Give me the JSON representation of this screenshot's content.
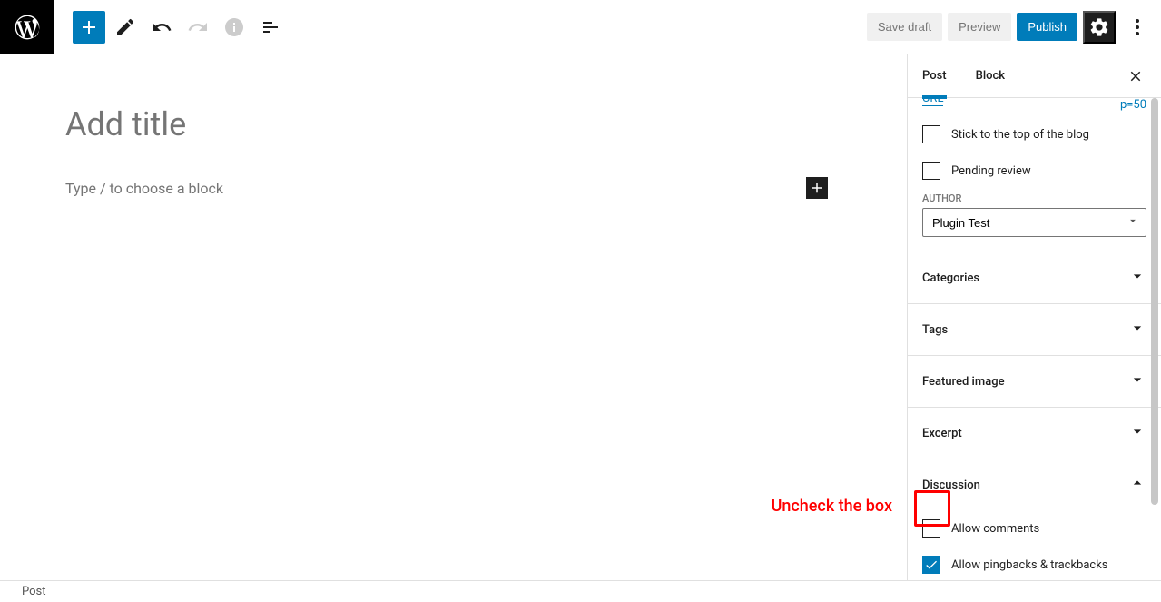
{
  "header": {
    "save_draft": "Save draft",
    "preview": "Preview",
    "publish": "Publish"
  },
  "editor": {
    "title_placeholder": "Add title",
    "block_placeholder": "Type / to choose a block"
  },
  "sidebar": {
    "tabs": {
      "post": "Post",
      "block": "Block"
    },
    "url_left": "URL",
    "url_right": "p=50",
    "stick_top": "Stick to the top of the blog",
    "pending_review": "Pending review",
    "author_label": "Author",
    "author_value": "Plugin Test",
    "panels": {
      "categories": "Categories",
      "tags": "Tags",
      "featured_image": "Featured image",
      "excerpt": "Excerpt",
      "discussion": "Discussion"
    },
    "discussion": {
      "allow_comments": "Allow comments",
      "allow_pingbacks": "Allow pingbacks & trackbacks"
    }
  },
  "annotation": {
    "text": "Uncheck the box"
  },
  "footer": {
    "breadcrumb": "Post"
  }
}
